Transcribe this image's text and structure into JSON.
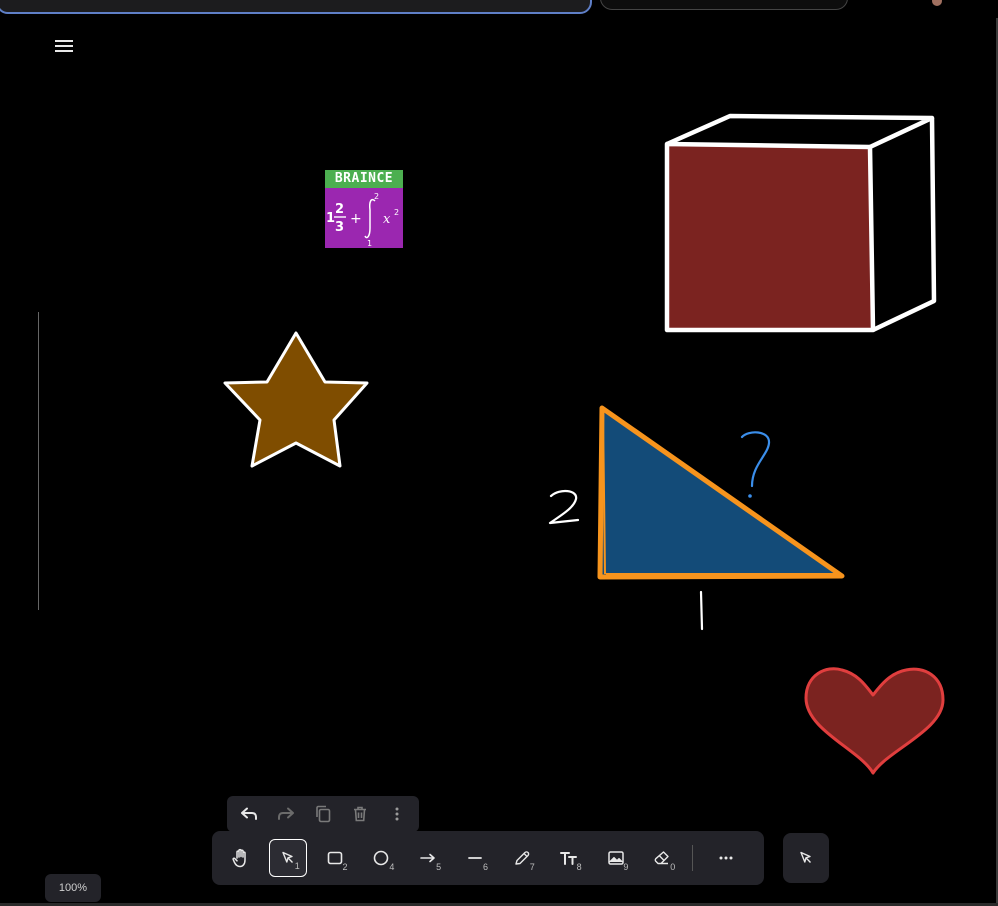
{
  "app": {
    "menu_icon": "hamburger-icon"
  },
  "canvas": {
    "background": "#000000",
    "logo": {
      "band_text": "BRAINCE",
      "band_color": "#4caf50",
      "tile_color": "#9b27b0",
      "formula": {
        "whole": "1",
        "numerator": "2",
        "denominator": "3",
        "operator": "+",
        "upper_limit": "2",
        "lower_limit": "1",
        "integrand": "x",
        "exponent": "2"
      }
    },
    "labels": {
      "triangle_side_vertical": "2",
      "triangle_side_bottom": "1",
      "hypotenuse_unknown": "?"
    },
    "shape_colors": {
      "star_fill": "#7f4d00",
      "cube_fill": "#7b2320",
      "triangle_fill": "#134b78",
      "triangle_stroke": "#f7941d",
      "heart_fill": "#7b2320",
      "heart_stroke": "#e03e3e",
      "question_color": "#3b8eea"
    }
  },
  "action_bar": [
    {
      "name": "undo-button",
      "icon": "undo-icon"
    },
    {
      "name": "redo-button",
      "icon": "redo-icon"
    },
    {
      "name": "duplicate-button",
      "icon": "duplicate-icon"
    },
    {
      "name": "delete-button",
      "icon": "trash-icon"
    },
    {
      "name": "more-actions-button",
      "icon": "vertical-dots-icon"
    }
  ],
  "toolbar": {
    "tools": [
      {
        "name": "hand",
        "icon": "hand-icon",
        "key": ""
      },
      {
        "name": "select",
        "icon": "pointer-icon",
        "key": "1",
        "active": true
      },
      {
        "name": "rectangle",
        "icon": "square-icon",
        "key": "2"
      },
      {
        "name": "ellipse",
        "icon": "circle-icon",
        "key": "4"
      },
      {
        "name": "arrow",
        "icon": "arrow-icon",
        "key": "5"
      },
      {
        "name": "line",
        "icon": "line-icon",
        "key": "6"
      },
      {
        "name": "draw",
        "icon": "pencil-icon",
        "key": "7"
      },
      {
        "name": "text",
        "icon": "text-icon",
        "key": "8"
      },
      {
        "name": "image",
        "icon": "image-icon",
        "key": "9"
      },
      {
        "name": "eraser",
        "icon": "eraser-icon",
        "key": "0"
      }
    ],
    "more_icon": "horizontal-dots-icon",
    "side_icon": "laser-pointer-icon"
  },
  "zoom": {
    "level": "100%"
  }
}
